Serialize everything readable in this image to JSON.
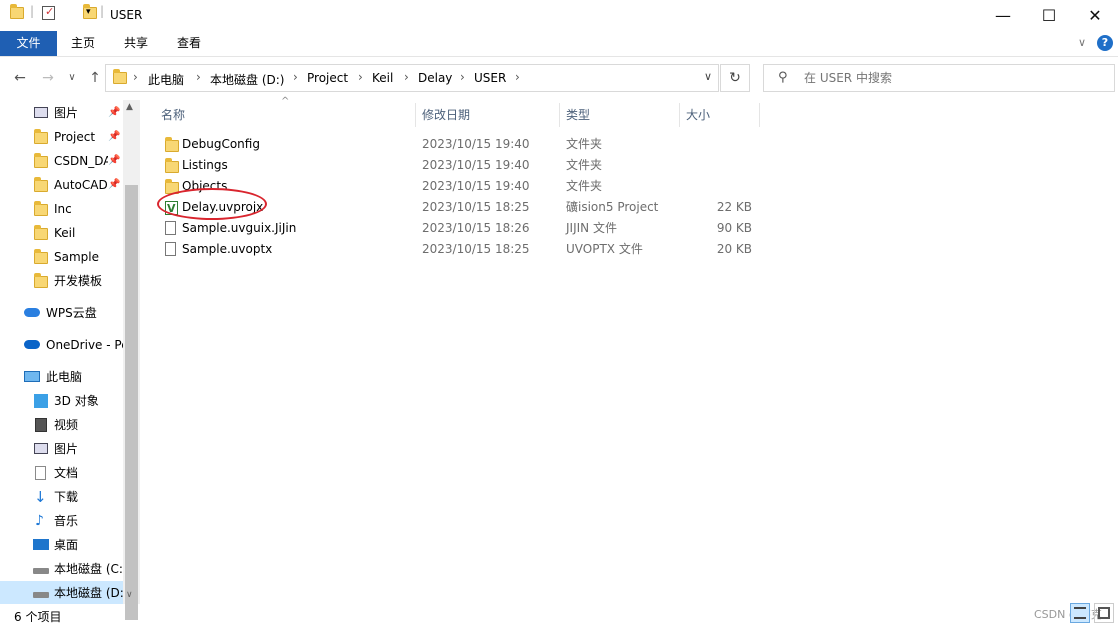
{
  "window": {
    "title": "USER",
    "minimize_icon": "minimize-icon",
    "maximize_icon": "maximize-icon",
    "close_icon": "close-icon"
  },
  "ribbon": {
    "tabs": [
      "文件",
      "主页",
      "共享",
      "查看"
    ]
  },
  "address": {
    "breadcrumbs": [
      "此电脑",
      "本地磁盘 (D:)",
      "Project",
      "Keil",
      "Delay",
      "USER"
    ]
  },
  "search": {
    "placeholder": "在 USER 中搜索"
  },
  "sidebar": {
    "items": [
      {
        "label": "图片",
        "icon": "pictures-icon",
        "pinned": true
      },
      {
        "label": "Project",
        "icon": "folder-icon",
        "pinned": true
      },
      {
        "label": "CSDN_DA",
        "icon": "folder-icon",
        "pinned": true
      },
      {
        "label": "AutoCAD",
        "icon": "folder-icon",
        "pinned": true
      },
      {
        "label": "Inc",
        "icon": "folder-icon",
        "pinned": false
      },
      {
        "label": "Keil",
        "icon": "folder-icon",
        "pinned": false
      },
      {
        "label": "Sample",
        "icon": "folder-icon",
        "pinned": false
      },
      {
        "label": "开发模板",
        "icon": "folder-icon",
        "pinned": false
      },
      {
        "label": "WPS云盘",
        "icon": "cloud-icon"
      },
      {
        "label": "OneDrive - Pe",
        "icon": "cloud-icon"
      },
      {
        "label": "此电脑",
        "icon": "computer-icon"
      },
      {
        "label": "3D 对象",
        "icon": "3d-objects-icon"
      },
      {
        "label": "视频",
        "icon": "video-icon"
      },
      {
        "label": "图片",
        "icon": "pictures-icon"
      },
      {
        "label": "文档",
        "icon": "documents-icon"
      },
      {
        "label": "下载",
        "icon": "download-icon"
      },
      {
        "label": "音乐",
        "icon": "music-icon"
      },
      {
        "label": "桌面",
        "icon": "desktop-icon"
      },
      {
        "label": "本地磁盘 (C:",
        "icon": "drive-icon"
      },
      {
        "label": "本地磁盘 (D:",
        "icon": "drive-icon",
        "selected": true
      }
    ]
  },
  "columns": {
    "name": "名称",
    "date": "修改日期",
    "type": "类型",
    "size": "大小"
  },
  "files": [
    {
      "name": "DebugConfig",
      "date": "2023/10/15 19:40",
      "type": "文件夹",
      "size": "",
      "icon": "folder-icon"
    },
    {
      "name": "Listings",
      "date": "2023/10/15 19:40",
      "type": "文件夹",
      "size": "",
      "icon": "folder-icon"
    },
    {
      "name": "Objects",
      "date": "2023/10/15 19:40",
      "type": "文件夹",
      "size": "",
      "icon": "folder-icon"
    },
    {
      "name": "Delay.uvprojx",
      "date": "2023/10/15 18:25",
      "type": "礦ision5 Project",
      "size": "22 KB",
      "icon": "uvision-project-icon"
    },
    {
      "name": "Sample.uvguix.JiJin",
      "date": "2023/10/15 18:26",
      "type": "JIJIN 文件",
      "size": "90 KB",
      "icon": "file-icon"
    },
    {
      "name": "Sample.uvoptx",
      "date": "2023/10/15 18:25",
      "type": "UVOPTX 文件",
      "size": "20 KB",
      "icon": "file-icon"
    }
  ],
  "status": {
    "count": "6 个项目"
  },
  "watermark": "CSDN @莎克",
  "colors": {
    "file_tab": "#1f5fb3",
    "highlight_circle": "#d9252e",
    "selected_nav": "#cce8ff"
  }
}
